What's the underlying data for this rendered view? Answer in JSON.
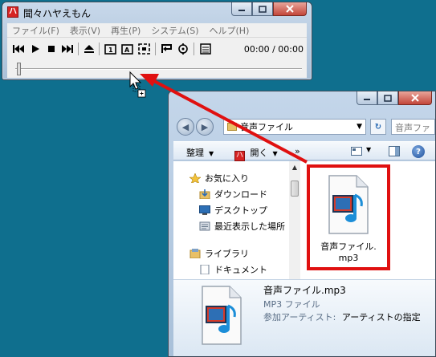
{
  "player": {
    "title": "聞々ハヤえもん",
    "app_icon_glyph": "ハ",
    "menu": [
      "ファイル(F)",
      "表示(V)",
      "再生(P)",
      "システム(S)",
      "ヘルプ(H)"
    ],
    "time_display": "00:00 / 00:00",
    "seek_position": 0
  },
  "explorer": {
    "address": "音声ファイル",
    "search_placeholder": "音声ファ",
    "commands": {
      "organize": "整理",
      "open": "開く",
      "more": "»"
    },
    "nav_pane": {
      "favorites": "お気に入り",
      "favorites_items": [
        "ダウンロード",
        "デスクトップ",
        "最近表示した場所"
      ],
      "libraries": "ライブラリ",
      "libraries_partial": "ドキュメント"
    },
    "file": {
      "name_line1": "音声ファイル.",
      "name_line2": "mp3"
    },
    "details": {
      "name": "音声ファイル.mp3",
      "type": "MP3 ファイル",
      "artist_label": "参加アーティスト:",
      "artist_value": "アーティストの指定"
    }
  },
  "colors": {
    "desktop": "#0f6f8e",
    "highlight": "#e01010",
    "drag_arrow": "#e01010"
  }
}
